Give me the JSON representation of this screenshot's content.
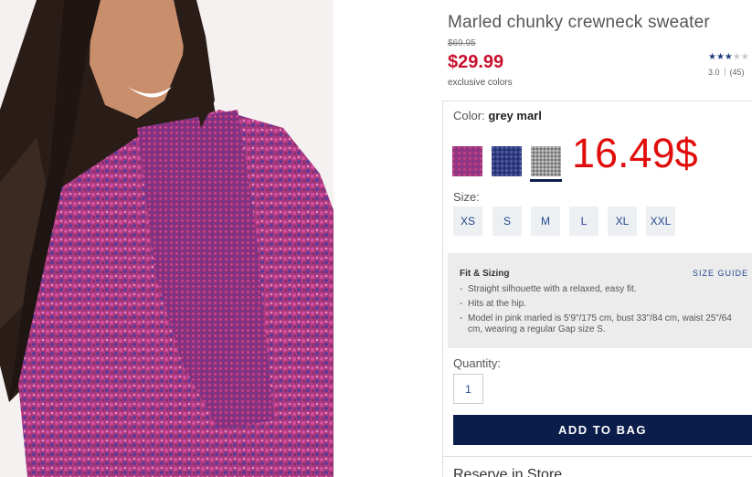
{
  "product": {
    "title": "Marled chunky crewneck sweater",
    "was_price": "$69.95",
    "price": "$29.99",
    "note": "exclusive colors",
    "rating_value": 3,
    "rating_score": "3.0",
    "review_count": "(45)"
  },
  "color": {
    "label": "Color:",
    "selected": "grey marl",
    "swatches": [
      {
        "name": "pink marl",
        "color": "#b23f86"
      },
      {
        "name": "blue marl",
        "color": "#3b4a8c"
      },
      {
        "name": "grey marl",
        "color": "#a8a8a8"
      }
    ]
  },
  "annotation": "16.49$",
  "size": {
    "label": "Size:",
    "options": [
      "XS",
      "S",
      "M",
      "L",
      "XL",
      "XXL"
    ]
  },
  "fit": {
    "title": "Fit & Sizing",
    "guide_link": "SIZE GUIDE",
    "bullets": [
      "Straight silhouette with a relaxed, easy fit.",
      "Hits at the hip.",
      "Model in pink marled is 5'9\"/175 cm, bust 33\"/84 cm, waist 25\"/64 cm, wearing a regular Gap size S."
    ]
  },
  "quantity": {
    "label": "Quantity:",
    "value": "1"
  },
  "cta": {
    "add_to_bag": "ADD TO BAG"
  },
  "reserve": {
    "label": "Reserve in Store"
  },
  "colors": {
    "price_red": "#c8102e",
    "navy": "#0b1d4a",
    "link_blue": "#24488f",
    "annotation_red": "#e10d0d"
  }
}
